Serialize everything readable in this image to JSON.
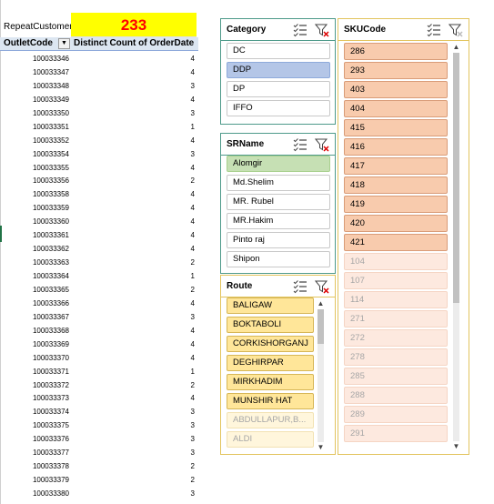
{
  "pivot": {
    "title": "RepeatCustomer",
    "total": "233",
    "header_outlet": "OutletCode",
    "header_filter_glyph": "▼",
    "header_count": "Distinct Count of OrderDate",
    "rows": [
      {
        "outlet": "100033346",
        "count": "4"
      },
      {
        "outlet": "100033347",
        "count": "4"
      },
      {
        "outlet": "100033348",
        "count": "3"
      },
      {
        "outlet": "100033349",
        "count": "4"
      },
      {
        "outlet": "100033350",
        "count": "3"
      },
      {
        "outlet": "100033351",
        "count": "1"
      },
      {
        "outlet": "100033352",
        "count": "4"
      },
      {
        "outlet": "100033354",
        "count": "3"
      },
      {
        "outlet": "100033355",
        "count": "4"
      },
      {
        "outlet": "100033356",
        "count": "2"
      },
      {
        "outlet": "100033358",
        "count": "4"
      },
      {
        "outlet": "100033359",
        "count": "4"
      },
      {
        "outlet": "100033360",
        "count": "4"
      },
      {
        "outlet": "100033361",
        "count": "4"
      },
      {
        "outlet": "100033362",
        "count": "4"
      },
      {
        "outlet": "100033363",
        "count": "2"
      },
      {
        "outlet": "100033364",
        "count": "1"
      },
      {
        "outlet": "100033365",
        "count": "2"
      },
      {
        "outlet": "100033366",
        "count": "4"
      },
      {
        "outlet": "100033367",
        "count": "3"
      },
      {
        "outlet": "100033368",
        "count": "4"
      },
      {
        "outlet": "100033369",
        "count": "4"
      },
      {
        "outlet": "100033370",
        "count": "4"
      },
      {
        "outlet": "100033371",
        "count": "1"
      },
      {
        "outlet": "100033372",
        "count": "2"
      },
      {
        "outlet": "100033373",
        "count": "4"
      },
      {
        "outlet": "100033374",
        "count": "3"
      },
      {
        "outlet": "100033375",
        "count": "3"
      },
      {
        "outlet": "100033376",
        "count": "3"
      },
      {
        "outlet": "100033377",
        "count": "3"
      },
      {
        "outlet": "100033378",
        "count": "2"
      },
      {
        "outlet": "100033379",
        "count": "2"
      },
      {
        "outlet": "100033380",
        "count": "3"
      }
    ]
  },
  "slicers": {
    "category": {
      "title": "Category",
      "items": [
        {
          "label": "DC",
          "state": "off"
        },
        {
          "label": "DDP",
          "state": "on"
        },
        {
          "label": "DP",
          "state": "off"
        },
        {
          "label": "IFFO",
          "state": "off"
        }
      ]
    },
    "srname": {
      "title": "SRName",
      "items": [
        {
          "label": "Alomgir",
          "state": "on"
        },
        {
          "label": "Md.Shelim",
          "state": "off"
        },
        {
          "label": "MR. Rubel",
          "state": "off"
        },
        {
          "label": "MR.Hakim",
          "state": "off"
        },
        {
          "label": "Pinto raj",
          "state": "off"
        },
        {
          "label": "Shipon",
          "state": "off"
        }
      ]
    },
    "route": {
      "title": "Route",
      "items": [
        {
          "label": "BALIGAW",
          "state": "on"
        },
        {
          "label": "BOKTABOLI",
          "state": "on"
        },
        {
          "label": "CORKISHORGANJ",
          "state": "on"
        },
        {
          "label": "DEGHIRPAR",
          "state": "on"
        },
        {
          "label": "MIRKHADIM",
          "state": "on"
        },
        {
          "label": "MUNSHIR HAT",
          "state": "on"
        },
        {
          "label": "ABDULLAPUR,B...",
          "state": "nodata"
        },
        {
          "label": "ALDI",
          "state": "nodata"
        }
      ],
      "scroll_position": 0.0
    },
    "sku": {
      "title": "SKUCode",
      "items": [
        {
          "label": "286",
          "state": "on"
        },
        {
          "label": "293",
          "state": "on"
        },
        {
          "label": "403",
          "state": "on"
        },
        {
          "label": "404",
          "state": "on"
        },
        {
          "label": "415",
          "state": "on"
        },
        {
          "label": "416",
          "state": "on"
        },
        {
          "label": "417",
          "state": "on"
        },
        {
          "label": "418",
          "state": "on"
        },
        {
          "label": "419",
          "state": "on"
        },
        {
          "label": "420",
          "state": "on"
        },
        {
          "label": "421",
          "state": "on"
        },
        {
          "label": "104",
          "state": "nodata"
        },
        {
          "label": "107",
          "state": "nodata"
        },
        {
          "label": "114",
          "state": "nodata"
        },
        {
          "label": "271",
          "state": "nodata"
        },
        {
          "label": "272",
          "state": "nodata"
        },
        {
          "label": "278",
          "state": "nodata"
        },
        {
          "label": "285",
          "state": "nodata"
        },
        {
          "label": "288",
          "state": "nodata"
        },
        {
          "label": "289",
          "state": "nodata"
        },
        {
          "label": "291",
          "state": "nodata"
        }
      ],
      "scroll_position": 0.0
    }
  },
  "icons": {
    "multiselect": "multi-select-icon",
    "clear_filter": "clear-filter-icon",
    "scroll_up": "▲",
    "scroll_down": "▼"
  },
  "colors": {
    "total_bg": "#ffff00",
    "total_text": "#ff0000",
    "category_selected": "#b4c6e7",
    "srname_selected": "#c6e0b4",
    "route_selected": "#ffe699",
    "sku_selected": "#f8cbad"
  }
}
